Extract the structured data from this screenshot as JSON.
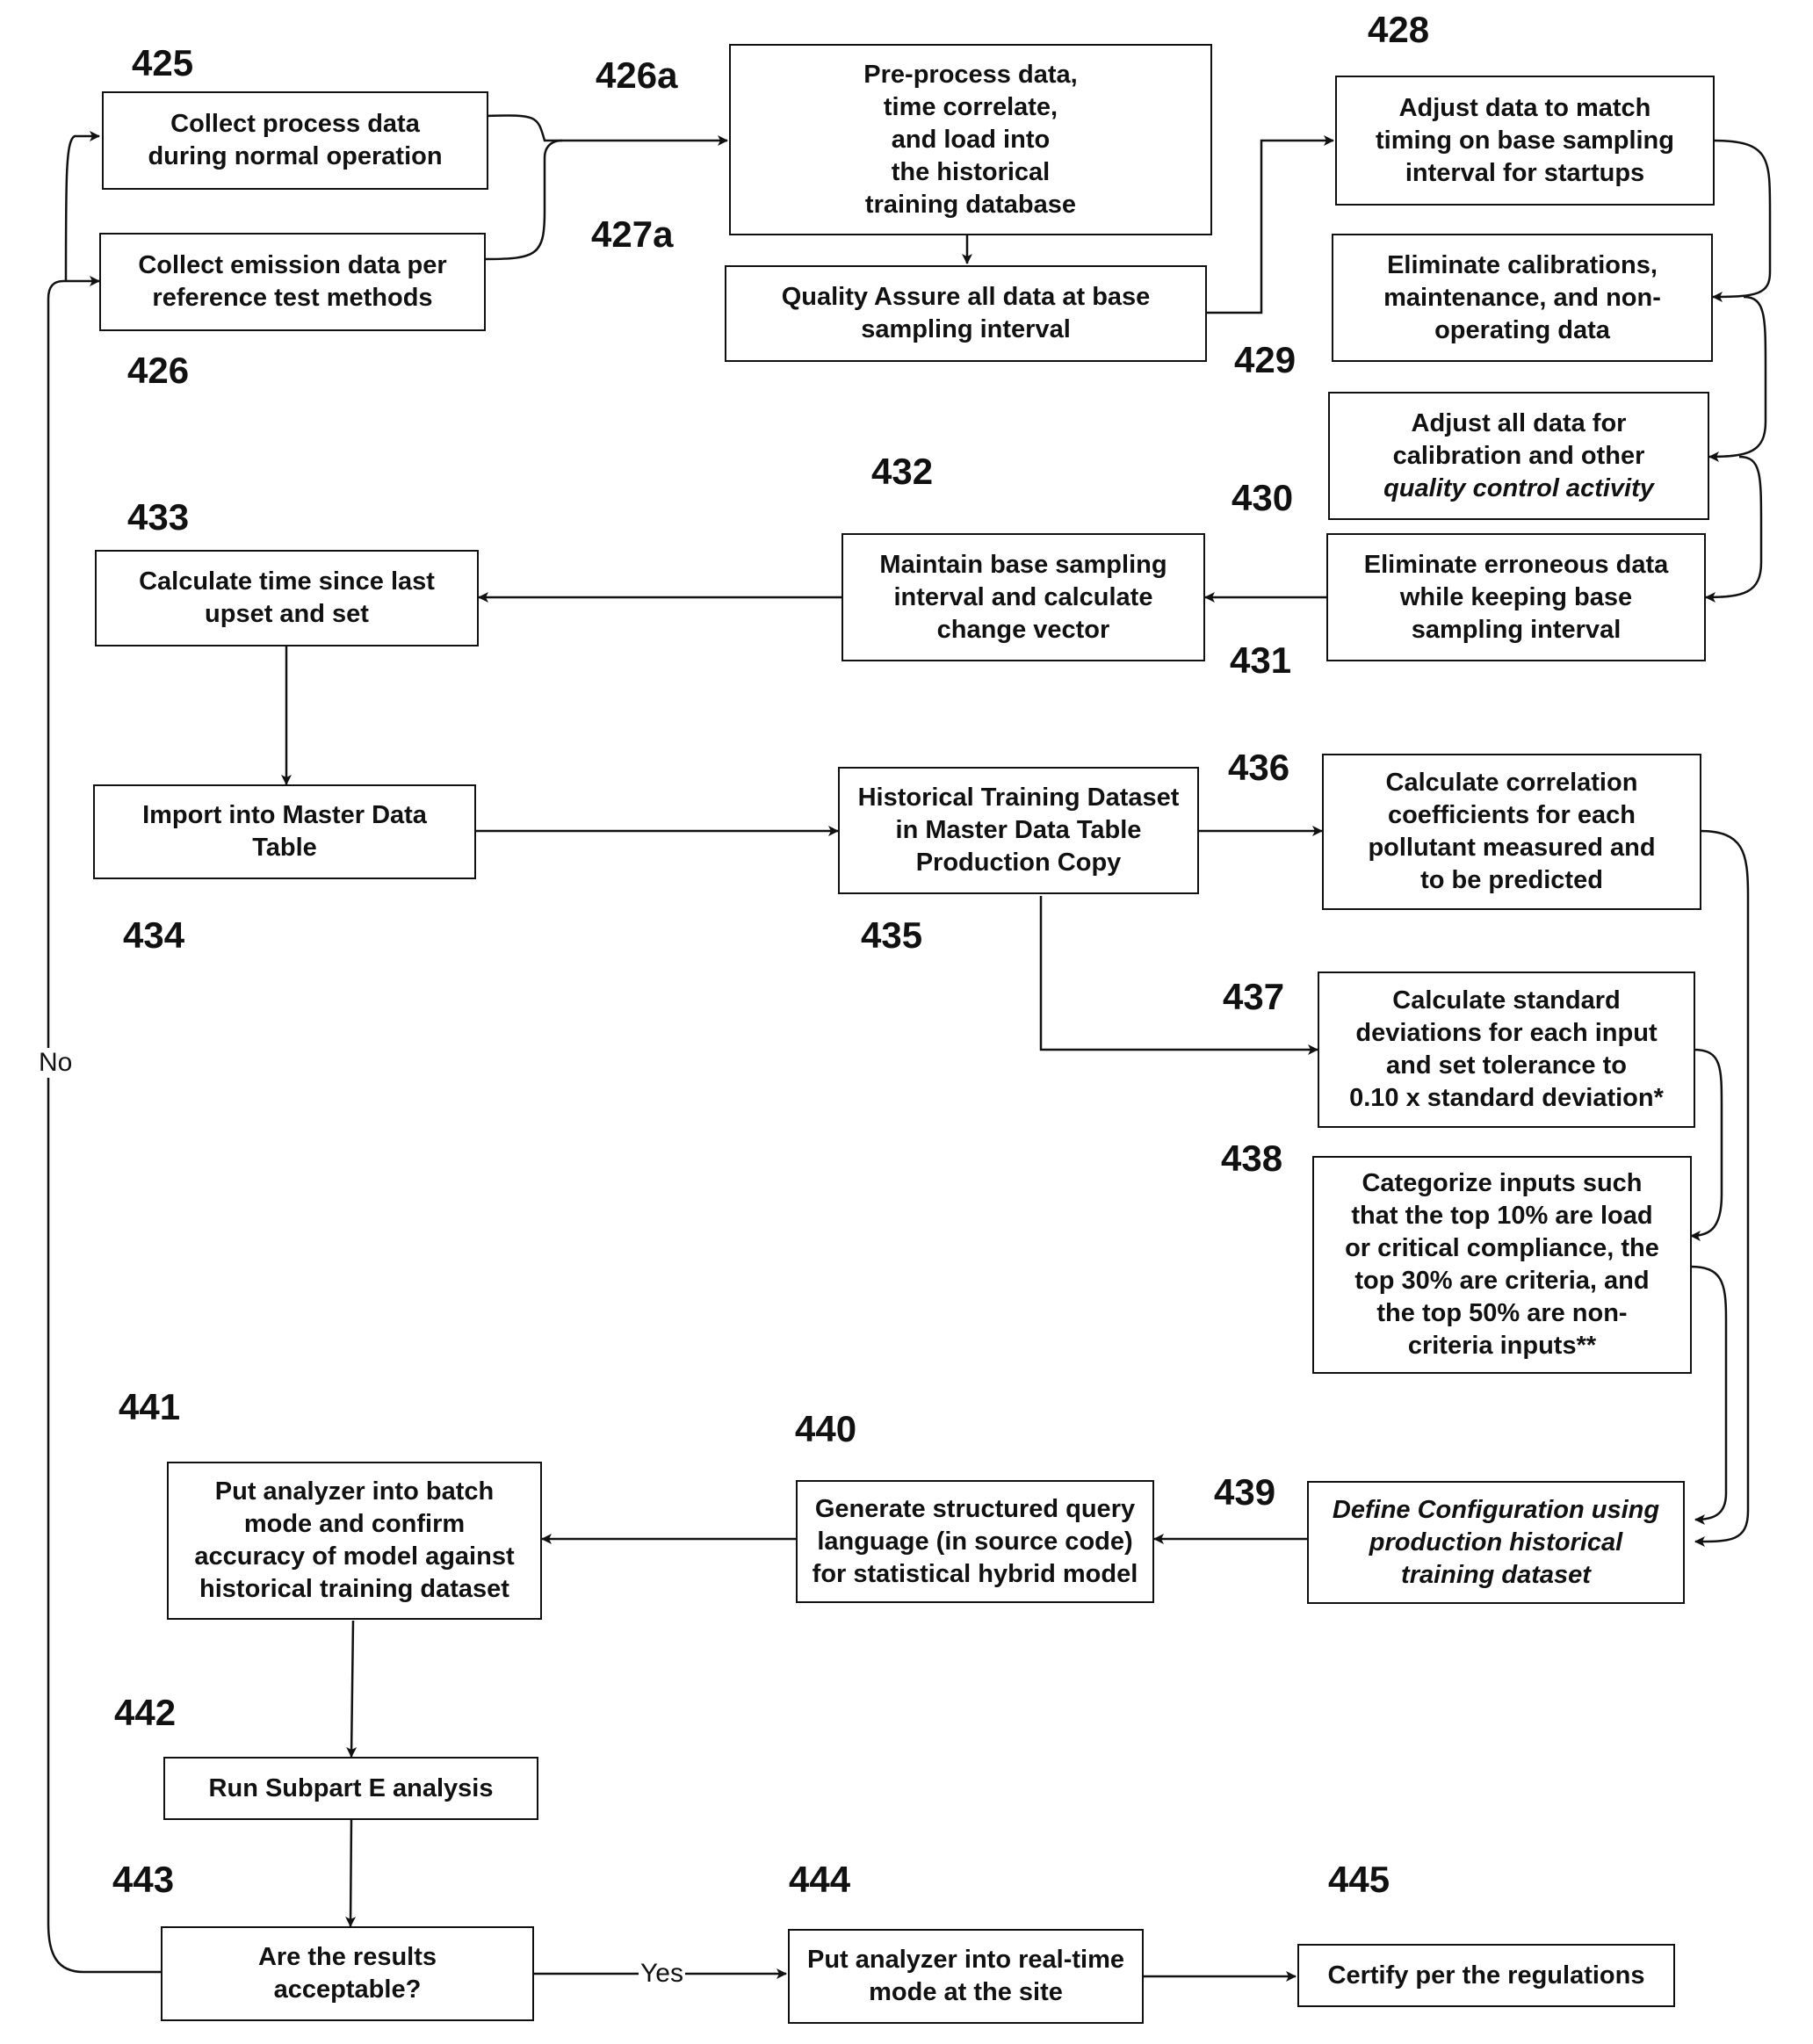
{
  "diagram": {
    "type": "flowchart",
    "nodes": [
      {
        "id": "425",
        "ref": "425",
        "text": "Collect process data\nduring normal operation"
      },
      {
        "id": "426",
        "ref": "426",
        "text": "Collect emission data per\nreference test methods"
      },
      {
        "id": "426a",
        "ref": "426a",
        "text": "Pre-process data,\ntime correlate,\nand load into\nthe historical\ntraining database"
      },
      {
        "id": "427a",
        "ref": "427a",
        "text": "Quality Assure all data at base\nsampling interval"
      },
      {
        "id": "428",
        "ref": "428",
        "text": "Adjust data to match\ntiming on base sampling\ninterval for startups"
      },
      {
        "id": "429",
        "ref": "429",
        "text": "Eliminate calibrations,\nmaintenance, and non-\noperating data"
      },
      {
        "id": "430",
        "ref": "430",
        "text_line1": "Adjust all data for\ncalibration and other",
        "text_line2": "quality control activity"
      },
      {
        "id": "431",
        "ref": "431",
        "text": "Eliminate erroneous data\nwhile keeping base\nsampling interval"
      },
      {
        "id": "432",
        "ref": "432",
        "text": "Maintain base sampling\ninterval and calculate\nchange vector"
      },
      {
        "id": "433",
        "ref": "433",
        "text": "Calculate time since last\nupset and set"
      },
      {
        "id": "434",
        "ref": "434",
        "text": "Import into Master Data\nTable"
      },
      {
        "id": "435",
        "ref": "435",
        "text": "Historical Training Dataset\nin Master Data Table\nProduction Copy"
      },
      {
        "id": "436",
        "ref": "436",
        "text": "Calculate correlation\ncoefficients for each\npollutant measured and\nto be predicted"
      },
      {
        "id": "437",
        "ref": "437",
        "text": "Calculate standard\ndeviations for each input\nand set tolerance to\n0.10 x standard deviation*"
      },
      {
        "id": "438",
        "ref": "438",
        "text": "Categorize inputs such\nthat the top 10% are load\nor critical compliance, the\ntop 30% are criteria, and\nthe top 50% are non-\ncriteria inputs**"
      },
      {
        "id": "439",
        "ref": "439",
        "text": "Define Configuration using\nproduction historical\ntraining dataset"
      },
      {
        "id": "440",
        "ref": "440",
        "text": "Generate structured query\nlanguage (in source code)\nfor statistical hybrid model"
      },
      {
        "id": "441",
        "ref": "441",
        "text": "Put analyzer into batch\nmode and confirm\naccuracy of model against\nhistorical training dataset"
      },
      {
        "id": "442",
        "ref": "442",
        "text": "Run Subpart E analysis"
      },
      {
        "id": "443",
        "ref": "443",
        "text": "Are the results\nacceptable?"
      },
      {
        "id": "444",
        "ref": "444",
        "text": "Put analyzer into real-time\nmode at the site"
      },
      {
        "id": "445",
        "ref": "445",
        "text": "Certify per the regulations"
      }
    ],
    "edge_labels": {
      "yes": "Yes",
      "no": "No"
    },
    "edges": [
      [
        "425",
        "426a"
      ],
      [
        "426",
        "426a"
      ],
      [
        "426a",
        "427a"
      ],
      [
        "427a",
        "428"
      ],
      [
        "428",
        "429"
      ],
      [
        "429",
        "430"
      ],
      [
        "430",
        "431"
      ],
      [
        "431",
        "432"
      ],
      [
        "432",
        "433"
      ],
      [
        "433",
        "434"
      ],
      [
        "434",
        "435"
      ],
      [
        "435",
        "436"
      ],
      [
        "435",
        "437"
      ],
      [
        "437",
        "438"
      ],
      [
        "436",
        "439"
      ],
      [
        "438",
        "439"
      ],
      [
        "439",
        "440"
      ],
      [
        "440",
        "441"
      ],
      [
        "441",
        "442"
      ],
      [
        "442",
        "443"
      ],
      [
        "443",
        "444",
        "Yes"
      ],
      [
        "444",
        "445"
      ],
      [
        "443",
        "425",
        "No"
      ],
      [
        "443",
        "426",
        "No"
      ]
    ]
  }
}
